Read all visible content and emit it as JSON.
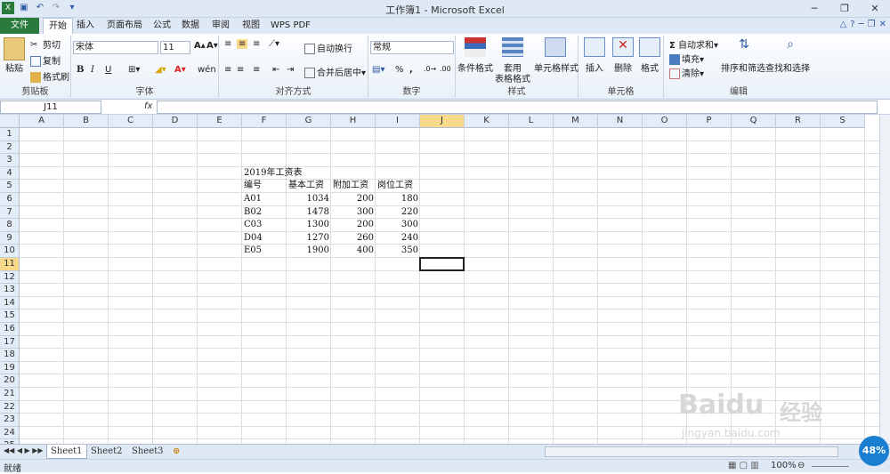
{
  "window": {
    "title": "工作簿1 - Microsoft Excel"
  },
  "tabs": [
    "文件",
    "开始",
    "插入",
    "页面布局",
    "公式",
    "数据",
    "审阅",
    "视图",
    "WPS PDF"
  ],
  "ribbon": {
    "clipboard": {
      "label": "剪贴板",
      "paste": "粘贴",
      "cut": "剪切",
      "copy": "复制",
      "format_painter": "格式刷"
    },
    "font": {
      "label": "字体",
      "font_name": "宋体",
      "font_size": "11",
      "bold": "B",
      "italic": "I",
      "underline": "U",
      "font_color_letter": "A",
      "phonetic": "wén"
    },
    "alignment": {
      "label": "对齐方式",
      "wrap": "自动换行",
      "merge": "合并后居中"
    },
    "number": {
      "label": "数字",
      "format": "常规",
      "percent": "%",
      "comma": ","
    },
    "styles": {
      "label": "样式",
      "conditional": "条件格式",
      "table_fmt_1": "套用",
      "table_fmt_2": "表格格式",
      "cell_styles": "单元格样式"
    },
    "cells": {
      "label": "单元格",
      "insert": "插入",
      "delete": "删除",
      "format": "格式"
    },
    "editing": {
      "label": "编辑",
      "autosum": "自动求和",
      "fill": "填充",
      "clear": "清除",
      "sort": "排序和筛选",
      "find": "查找和选择",
      "sigma": "Σ"
    }
  },
  "formula_bar": {
    "name_box": "J11",
    "fx": "fx",
    "formula": ""
  },
  "columns": [
    "A",
    "B",
    "C",
    "D",
    "E",
    "F",
    "G",
    "H",
    "I",
    "J",
    "K",
    "L",
    "M",
    "N",
    "O",
    "P",
    "Q",
    "R",
    "S"
  ],
  "rows": [
    "1",
    "2",
    "3",
    "4",
    "5",
    "6",
    "7",
    "8",
    "9",
    "10",
    "11",
    "12",
    "13",
    "14",
    "15",
    "16",
    "17",
    "18",
    "19",
    "20",
    "21",
    "22",
    "23",
    "24",
    "25"
  ],
  "selected_cell": "J11",
  "cells": {
    "title": "2019年工资表",
    "headers": [
      "编号",
      "基本工资",
      "附加工资",
      "岗位工资"
    ],
    "data": [
      [
        "A01",
        "1034",
        "200",
        "180"
      ],
      [
        "B02",
        "1478",
        "300",
        "220"
      ],
      [
        "C03",
        "1300",
        "200",
        "300"
      ],
      [
        "D04",
        "1270",
        "260",
        "240"
      ],
      [
        "E05",
        "1900",
        "400",
        "350"
      ]
    ]
  },
  "sheets": [
    "Sheet1",
    "Sheet2",
    "Sheet3"
  ],
  "active_sheet": "Sheet1",
  "status": {
    "ready": "就绪",
    "zoom": "100%"
  },
  "watermark": {
    "brand": "Baidu",
    "jingyan": "经验",
    "url": "jingyan.baidu.com",
    "badge": "48%"
  },
  "colors": {
    "file_tab": "#2a7a3b",
    "selection": "#f9d98a",
    "title_bg": "#dfe8f5"
  }
}
